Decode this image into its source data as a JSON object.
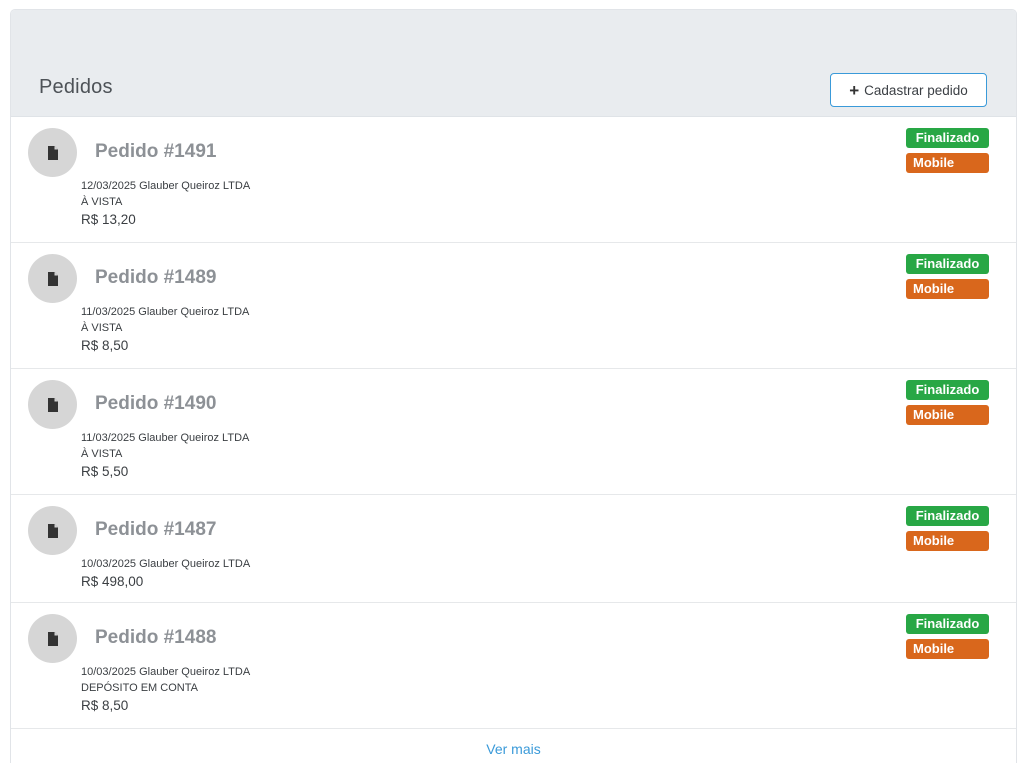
{
  "header": {
    "title": "Pedidos",
    "add_button_label": "Cadastrar pedido"
  },
  "orders": [
    {
      "title": "Pedido #1491",
      "info": "12/03/2025 Glauber Queiroz LTDA",
      "payment": "À VISTA",
      "total": "R$ 13,20",
      "status": "Finalizado",
      "origin": "Mobile"
    },
    {
      "title": "Pedido #1489",
      "info": "11/03/2025 Glauber Queiroz LTDA",
      "payment": "À VISTA",
      "total": "R$ 8,50",
      "status": "Finalizado",
      "origin": "Mobile"
    },
    {
      "title": "Pedido #1490",
      "info": "11/03/2025 Glauber Queiroz LTDA",
      "payment": "À VISTA",
      "total": "R$ 5,50",
      "status": "Finalizado",
      "origin": "Mobile"
    },
    {
      "title": "Pedido #1487",
      "info": "10/03/2025 Glauber Queiroz LTDA",
      "payment": "",
      "total": "R$ 498,00",
      "status": "Finalizado",
      "origin": "Mobile"
    },
    {
      "title": "Pedido #1488",
      "info": "10/03/2025 Glauber Queiroz LTDA",
      "payment": "DEPÓSITO EM CONTA",
      "total": "R$ 8,50",
      "status": "Finalizado",
      "origin": "Mobile"
    }
  ],
  "footer": {
    "more_label": "Ver mais"
  },
  "colors": {
    "status_finalizado": "#28a745",
    "origin_mobile": "#d9671c",
    "link": "#3a9ad9",
    "header_bg": "#e9ecef"
  },
  "icons": {
    "order_avatar": "document-icon",
    "add_button": "plus-icon"
  }
}
